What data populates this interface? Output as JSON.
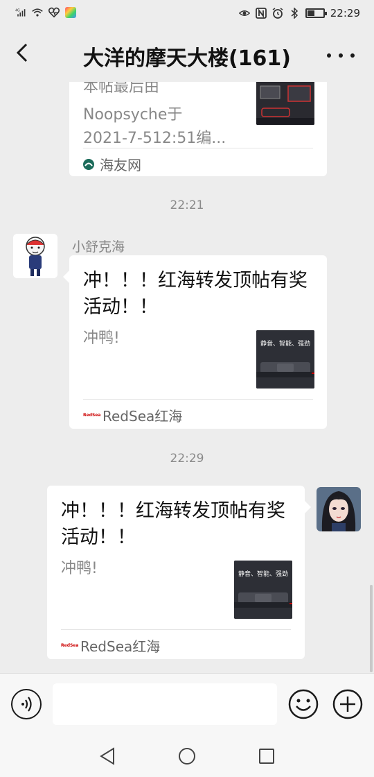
{
  "status_bar": {
    "network": "4G",
    "time": "22:29",
    "battery_level": 0.45
  },
  "header": {
    "title": "大洋的摩天大楼(161)",
    "back_icon": "chevron-left-icon",
    "more_icon": "more-horizontal-icon"
  },
  "messages": [
    {
      "card": {
        "title_partial": "本帖最后由",
        "desc_line1": "Noopsyche于",
        "desc_line2": "2021-7-512:51编...",
        "source": "海友网"
      }
    },
    {
      "time": "22:21",
      "sender": "小舒克海",
      "card": {
        "title": "冲！！！红海转发顶帖有奖活动！！",
        "desc": "冲鸭!",
        "thumb_text": "静音、智能、强劲",
        "source_logo": "RedSea",
        "source": "RedSea红海"
      }
    },
    {
      "time": "22:29",
      "card": {
        "title": "冲！！！红海转发顶帖有奖活动！！",
        "desc": "冲鸭!",
        "thumb_text": "静音、智能、强劲",
        "source_logo": "RedSea",
        "source": "RedSea红海"
      }
    }
  ],
  "input_bar": {
    "voice_icon": "voice-icon",
    "placeholder": "",
    "emoji_icon": "emoji-icon",
    "plus_icon": "plus-icon"
  },
  "colors": {
    "background": "#ededed",
    "bubble": "#ffffff",
    "accent_red": "#cc0000"
  }
}
